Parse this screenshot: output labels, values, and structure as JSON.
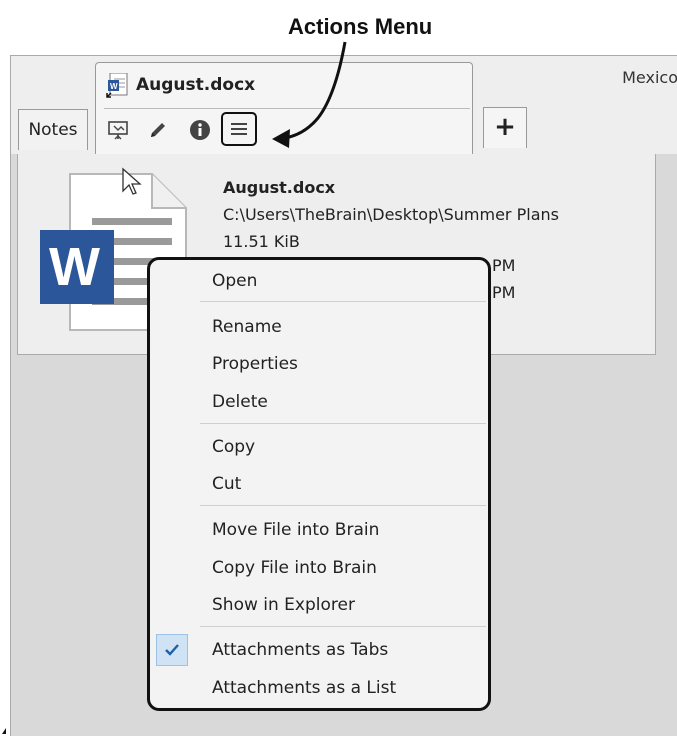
{
  "annotation": {
    "label": "Actions Menu"
  },
  "window": {
    "right_title": "Mexico"
  },
  "tabs": {
    "notes_label": "Notes",
    "active_title": "August.docx",
    "new_tab_label": "+"
  },
  "toolbar": {
    "icons": [
      "present-icon",
      "edit-pencil-icon",
      "info-icon",
      "hamburger-menu-icon"
    ]
  },
  "file": {
    "name": "August.docx",
    "path": "C:\\Users\\TheBrain\\Desktop\\Summer Plans",
    "size": "11.51 KiB",
    "partial_line1": "PM",
    "partial_line2": "PM"
  },
  "menu": {
    "items": [
      {
        "label": "Open"
      },
      {
        "label": "Rename"
      },
      {
        "label": "Properties"
      },
      {
        "label": "Delete"
      },
      {
        "label": "Copy"
      },
      {
        "label": "Cut"
      },
      {
        "label": "Move File into Brain"
      },
      {
        "label": "Copy File into Brain"
      },
      {
        "label": "Show in Explorer"
      },
      {
        "label": "Attachments as Tabs",
        "checked": true
      },
      {
        "label": "Attachments as a List",
        "checked": false
      }
    ]
  },
  "colors": {
    "word_blue": "#2b579a",
    "check_highlight": "#cfe3f5",
    "check_mark": "#1f5fa8"
  }
}
